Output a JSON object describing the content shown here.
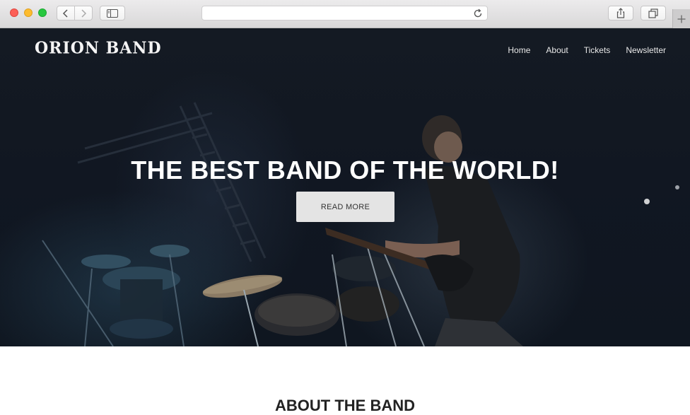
{
  "browser": {
    "url": "",
    "icons": {
      "back": "chevron-left-icon",
      "forward": "chevron-right-icon",
      "sidebar": "sidebar-icon",
      "reload": "reload-icon",
      "share": "share-icon",
      "tabs": "tabs-icon",
      "new_tab": "plus-icon"
    }
  },
  "site": {
    "brand": "ORION BAND",
    "nav": [
      "Home",
      "About",
      "Tickets",
      "Newsletter"
    ],
    "hero": {
      "title": "THE BEST BAND OF THE WORLD!",
      "button": "READ MORE"
    },
    "about": {
      "title": "ABOUT THE BAND"
    }
  },
  "colors": {
    "hero_bg": "#121923",
    "button_bg": "#e4e4e4",
    "text_light": "#ffffff"
  }
}
